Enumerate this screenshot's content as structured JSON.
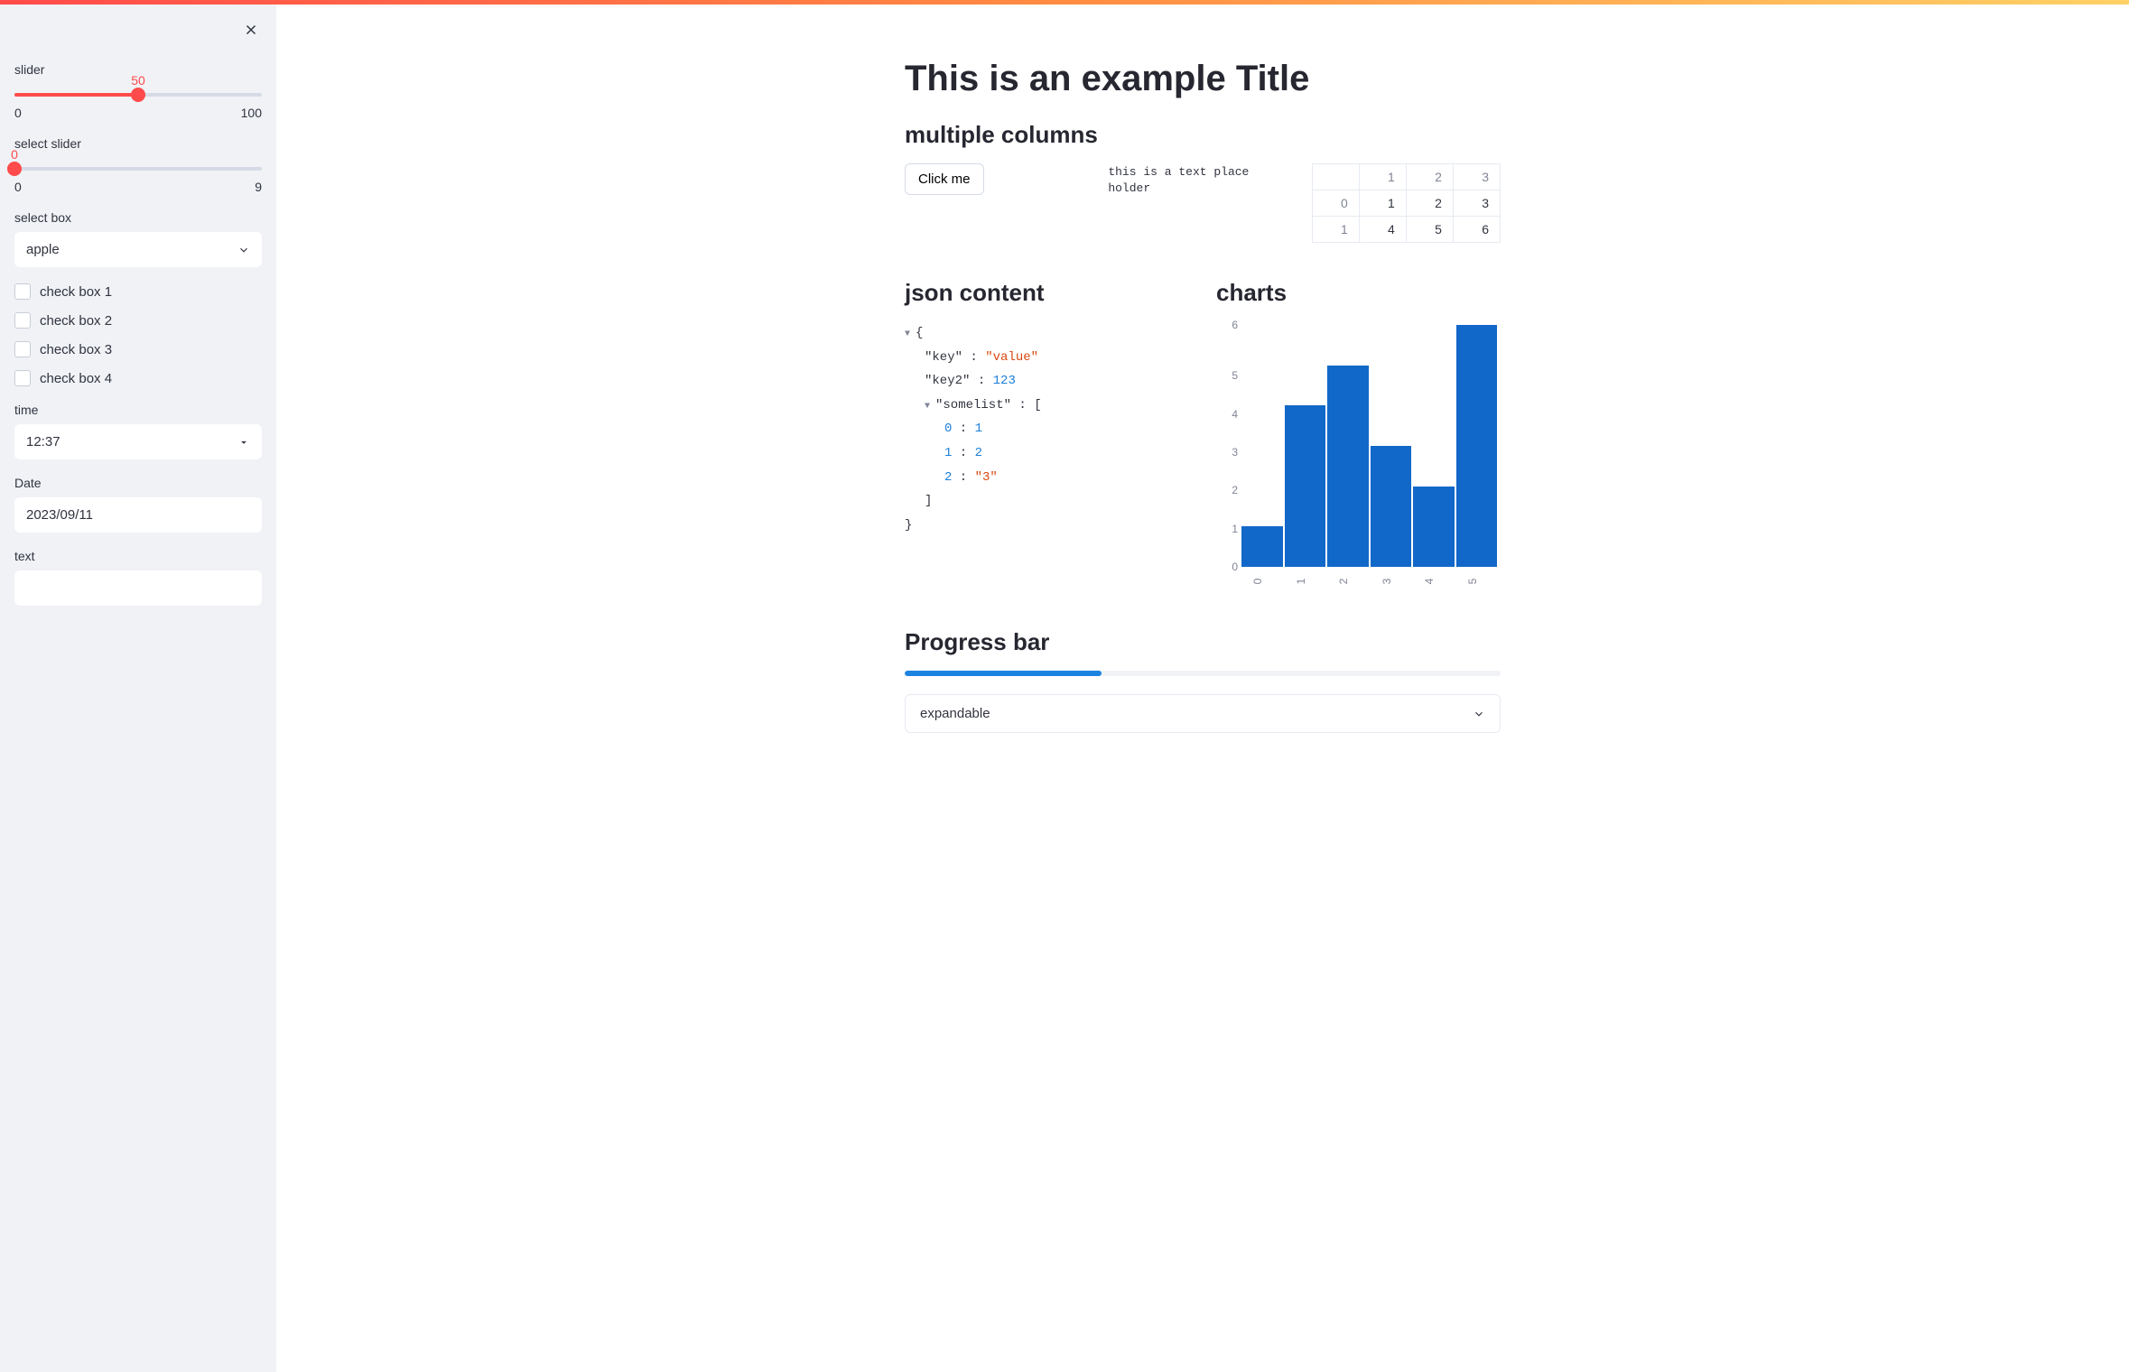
{
  "sidebar": {
    "slider": {
      "label": "slider",
      "value": "50",
      "min": "0",
      "max": "100",
      "percent": 50
    },
    "select_slider": {
      "label": "select slider",
      "value": "0",
      "min": "0",
      "max": "9",
      "percent": 0
    },
    "selectbox": {
      "label": "select box",
      "value": "apple"
    },
    "checkboxes": [
      {
        "label": "check box 1"
      },
      {
        "label": "check box 2"
      },
      {
        "label": "check box 3"
      },
      {
        "label": "check box 4"
      }
    ],
    "time": {
      "label": "time",
      "value": "12:37"
    },
    "date": {
      "label": "Date",
      "value": "2023/09/11"
    },
    "text": {
      "label": "text",
      "value": ""
    }
  },
  "main": {
    "title": "This is an example Title",
    "columns_heading": "multiple columns",
    "button_label": "Click me",
    "placeholder_text": "this is a text place holder",
    "table": {
      "col_headers": [
        "",
        "1",
        "2",
        "3"
      ],
      "rows": [
        {
          "idx": "0",
          "cells": [
            "1",
            "2",
            "3"
          ]
        },
        {
          "idx": "1",
          "cells": [
            "4",
            "5",
            "6"
          ]
        }
      ]
    },
    "json_heading": "json content",
    "json": {
      "key_label": "\"key\"",
      "key_value": "\"value\"",
      "key2_label": "\"key2\"",
      "key2_value": "123",
      "list_label": "\"somelist\"",
      "list_items": [
        {
          "idx": "0",
          "val": "1",
          "type": "num"
        },
        {
          "idx": "1",
          "val": "2",
          "type": "num"
        },
        {
          "idx": "2",
          "val": "\"3\"",
          "type": "str"
        }
      ]
    },
    "charts_heading": "charts",
    "progress_heading": "Progress bar",
    "progress_percent": 33,
    "expander_label": "expandable"
  },
  "chart_data": {
    "type": "bar",
    "categories": [
      "0",
      "1",
      "2",
      "3",
      "4",
      "5"
    ],
    "values": [
      1,
      4,
      5,
      3,
      2,
      6
    ],
    "title": "",
    "xlabel": "",
    "ylabel": "",
    "ylim": [
      0,
      6
    ],
    "yticks": [
      "6",
      "5",
      "4",
      "3",
      "2",
      "1",
      "0"
    ]
  }
}
